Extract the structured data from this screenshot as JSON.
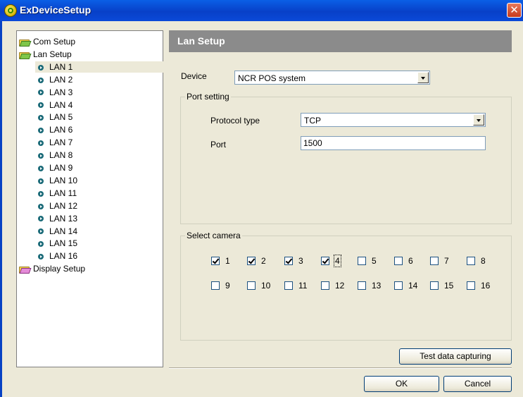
{
  "window": {
    "title": "ExDeviceSetup",
    "close_glyph": "✕"
  },
  "tree": {
    "items": [
      {
        "label": "Com Setup",
        "icon": "folder-icon",
        "level": 0
      },
      {
        "label": "Lan Setup",
        "icon": "folder-icon",
        "level": 0
      },
      {
        "label": "LAN 1",
        "icon": "bullet-icon",
        "level": 1,
        "selected": true
      },
      {
        "label": "LAN 2",
        "icon": "bullet-icon",
        "level": 1
      },
      {
        "label": "LAN 3",
        "icon": "bullet-icon",
        "level": 1
      },
      {
        "label": "LAN 4",
        "icon": "bullet-icon",
        "level": 1
      },
      {
        "label": "LAN 5",
        "icon": "bullet-icon",
        "level": 1
      },
      {
        "label": "LAN 6",
        "icon": "bullet-icon",
        "level": 1
      },
      {
        "label": "LAN 7",
        "icon": "bullet-icon",
        "level": 1
      },
      {
        "label": "LAN 8",
        "icon": "bullet-icon",
        "level": 1
      },
      {
        "label": "LAN 9",
        "icon": "bullet-icon",
        "level": 1
      },
      {
        "label": "LAN 10",
        "icon": "bullet-icon",
        "level": 1
      },
      {
        "label": "LAN 11",
        "icon": "bullet-icon",
        "level": 1
      },
      {
        "label": "LAN 12",
        "icon": "bullet-icon",
        "level": 1
      },
      {
        "label": "LAN 13",
        "icon": "bullet-icon",
        "level": 1
      },
      {
        "label": "LAN 14",
        "icon": "bullet-icon",
        "level": 1
      },
      {
        "label": "LAN 15",
        "icon": "bullet-icon",
        "level": 1
      },
      {
        "label": "LAN 16",
        "icon": "bullet-icon",
        "level": 1
      },
      {
        "label": "Display Setup",
        "icon": "folder-icon-pink",
        "level": 0
      }
    ]
  },
  "panel": {
    "header": "Lan Setup",
    "device_label": "Device",
    "device_value": "NCR POS system",
    "port_group_title": "Port setting",
    "protocol_label": "Protocol type",
    "protocol_value": "TCP",
    "port_label": "Port",
    "port_value": "1500",
    "camera_group_title": "Select camera",
    "cameras": [
      {
        "label": "1",
        "checked": true
      },
      {
        "label": "2",
        "checked": true
      },
      {
        "label": "3",
        "checked": true
      },
      {
        "label": "4",
        "checked": true,
        "focused": true
      },
      {
        "label": "5",
        "checked": false
      },
      {
        "label": "6",
        "checked": false
      },
      {
        "label": "7",
        "checked": false
      },
      {
        "label": "8",
        "checked": false
      },
      {
        "label": "9",
        "checked": false
      },
      {
        "label": "10",
        "checked": false
      },
      {
        "label": "11",
        "checked": false
      },
      {
        "label": "12",
        "checked": false
      },
      {
        "label": "13",
        "checked": false
      },
      {
        "label": "14",
        "checked": false
      },
      {
        "label": "15",
        "checked": false
      },
      {
        "label": "16",
        "checked": false
      }
    ],
    "test_button": "Test data capturing"
  },
  "footer": {
    "ok_label": "OK",
    "cancel_label": "Cancel"
  },
  "colors": {
    "titlebar": "#0840c8",
    "header_bar": "#8b8b8b",
    "dialog_bg": "#ece9d8"
  }
}
